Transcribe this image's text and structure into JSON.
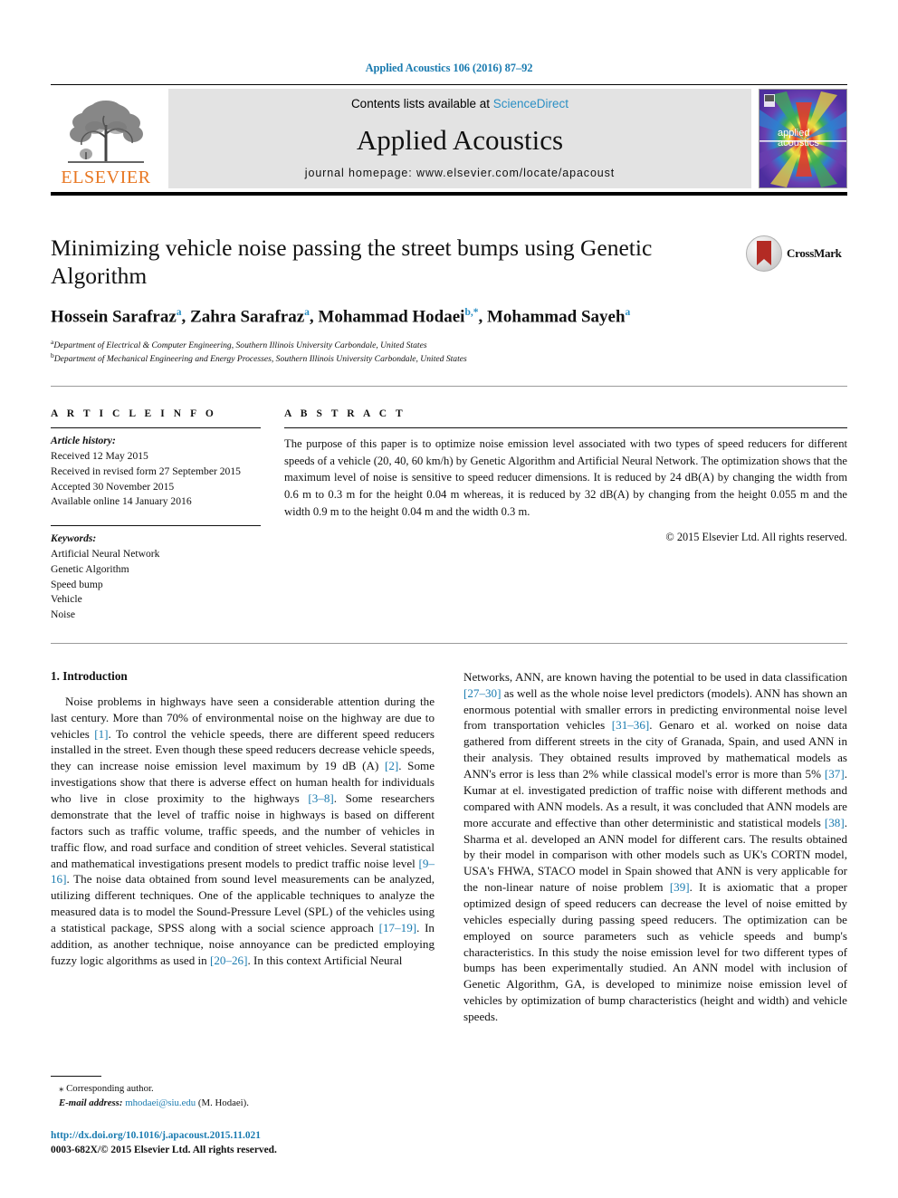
{
  "running_head": "Applied Acoustics 106 (2016) 87–92",
  "masthead": {
    "contents_prefix": "Contents lists available at ",
    "sciencedirect": "ScienceDirect",
    "journal_title": "Applied Acoustics",
    "homepage": "journal homepage: www.elsevier.com/locate/apacoust",
    "publisher_logo_text": "ELSEVIER",
    "cover_line1": "applied",
    "cover_line2": "acoustics",
    "accent_blue": "#2b8fc4",
    "elsevier_orange": "#E87722"
  },
  "article": {
    "title": "Minimizing vehicle noise passing the street bumps using Genetic Algorithm",
    "authors": [
      {
        "name": "Hossein Sarafraz",
        "marks": "a",
        "sep": ", "
      },
      {
        "name": "Zahra Sarafraz",
        "marks": "a",
        "sep": ", "
      },
      {
        "name": "Mohammad Hodaei",
        "marks": "b,*",
        "sep": ", "
      },
      {
        "name": "Mohammad Sayeh",
        "marks": "a",
        "sep": ""
      }
    ],
    "affiliations": [
      {
        "mark": "a",
        "text": "Department of Electrical & Computer Engineering, Southern Illinois University Carbondale, United States"
      },
      {
        "mark": "b",
        "text": "Department of Mechanical Engineering and Energy Processes, Southern Illinois University Carbondale, United States"
      }
    ],
    "crossmark_label": "CrossMark"
  },
  "article_info": {
    "heading": "A R T I C L E  I N F O",
    "history_label": "Article history:",
    "history": [
      "Received 12 May 2015",
      "Received in revised form 27 September 2015",
      "Accepted 30 November 2015",
      "Available online 14 January 2016"
    ],
    "keywords_label": "Keywords:",
    "keywords": [
      "Artificial Neural Network",
      "Genetic Algorithm",
      "Speed bump",
      "Vehicle",
      "Noise"
    ]
  },
  "abstract": {
    "heading": "A B S T R A C T",
    "text": "The purpose of this paper is to optimize noise emission level associated with two types of speed reducers for different speeds of a vehicle (20, 40, 60 km/h) by Genetic Algorithm and Artificial Neural Network. The optimization shows that the maximum level of noise is sensitive to speed reducer dimensions. It is reduced by 24 dB(A) by changing the width from 0.6 m to 0.3 m for the height 0.04 m whereas, it is reduced by 32 dB(A) by changing from the height 0.055 m and the width 0.9 m to the height 0.04 m and the width 0.3 m.",
    "copyright": "© 2015 Elsevier Ltd. All rights reserved."
  },
  "body": {
    "section_heading": "1. Introduction",
    "left_para_1": "Noise problems in highways have seen a considerable attention during the last century. More than 70% of environmental noise on the highway are due to vehicles ",
    "left_ref_1": "[1]",
    "left_para_2": ". To control the vehicle speeds, there are different speed reducers installed in the street. Even though these speed reducers decrease vehicle speeds, they can increase noise emission level maximum by 19 dB (A) ",
    "left_ref_2": "[2]",
    "left_para_3": ". Some investigations show that there is adverse effect on human health for individuals who live in close proximity to the highways ",
    "left_ref_3": "[3–8]",
    "left_para_4": ". Some researchers demonstrate that the level of traffic noise in highways is based on different factors such as traffic volume, traffic speeds, and the number of vehicles in traffic flow, and road surface and condition of street vehicles. Several statistical and mathematical investigations present models to predict traffic noise level ",
    "left_ref_4": "[9–16]",
    "left_para_5": ". The noise data obtained from sound level measurements can be analyzed, utilizing different techniques. One of the applicable techniques to analyze the measured data is to model the Sound-Pressure Level (SPL) of the vehicles using a statistical package, SPSS along with a social science approach ",
    "left_ref_5": "[17–19]",
    "left_para_6": ". In addition, as another technique, noise annoyance can be predicted employing fuzzy logic algorithms as used in ",
    "left_ref_6": "[20–26]",
    "left_para_7": ". In this context Artificial Neural",
    "right_para_1": "Networks, ANN, are known having the potential to be used in data classification ",
    "right_ref_1": "[27–30]",
    "right_para_2": " as well as the whole noise level predictors (models). ANN has shown an enormous potential with smaller errors in predicting environmental noise level from transportation vehicles ",
    "right_ref_2": "[31–36]",
    "right_para_3": ". Genaro et al. worked on noise data gathered from different streets in the city of Granada, Spain, and used ANN in their analysis. They obtained results improved by mathematical models as ANN's error is less than 2% while classical model's error is more than 5% ",
    "right_ref_3": "[37]",
    "right_para_4": ". Kumar at el. investigated prediction of traffic noise with different methods and compared with ANN models. As a result, it was concluded that ANN models are more accurate and effective than other deterministic and statistical models ",
    "right_ref_4": "[38]",
    "right_para_5": ". Sharma et al. developed an ANN model for different cars. The results obtained by their model in comparison with other models such as UK's CORTN model, USA's FHWA, STACO model in Spain showed that ANN is very applicable for the non-linear nature of noise problem ",
    "right_ref_5": "[39]",
    "right_para_6": ". It is axiomatic that a proper optimized design of speed reducers can decrease the level of noise emitted by vehicles especially during passing speed reducers. The optimization can be employed on source parameters such as vehicle speeds and bump's characteristics. In this study the noise emission level for two different types of bumps has been experimentally studied. An ANN model with inclusion of Genetic Algorithm, GA, is developed to minimize noise emission level of vehicles by optimization of bump characteristics (height and width) and vehicle speeds."
  },
  "footer": {
    "corresponding_marker": "⁎",
    "corresponding_author": "Corresponding author.",
    "email_label": "E-mail address:",
    "email": "mhodaei@siu.edu",
    "email_owner": "(M. Hodaei).",
    "doi": "http://dx.doi.org/10.1016/j.apacoust.2015.11.021",
    "issn": "0003-682X/© 2015 Elsevier Ltd. All rights reserved."
  }
}
